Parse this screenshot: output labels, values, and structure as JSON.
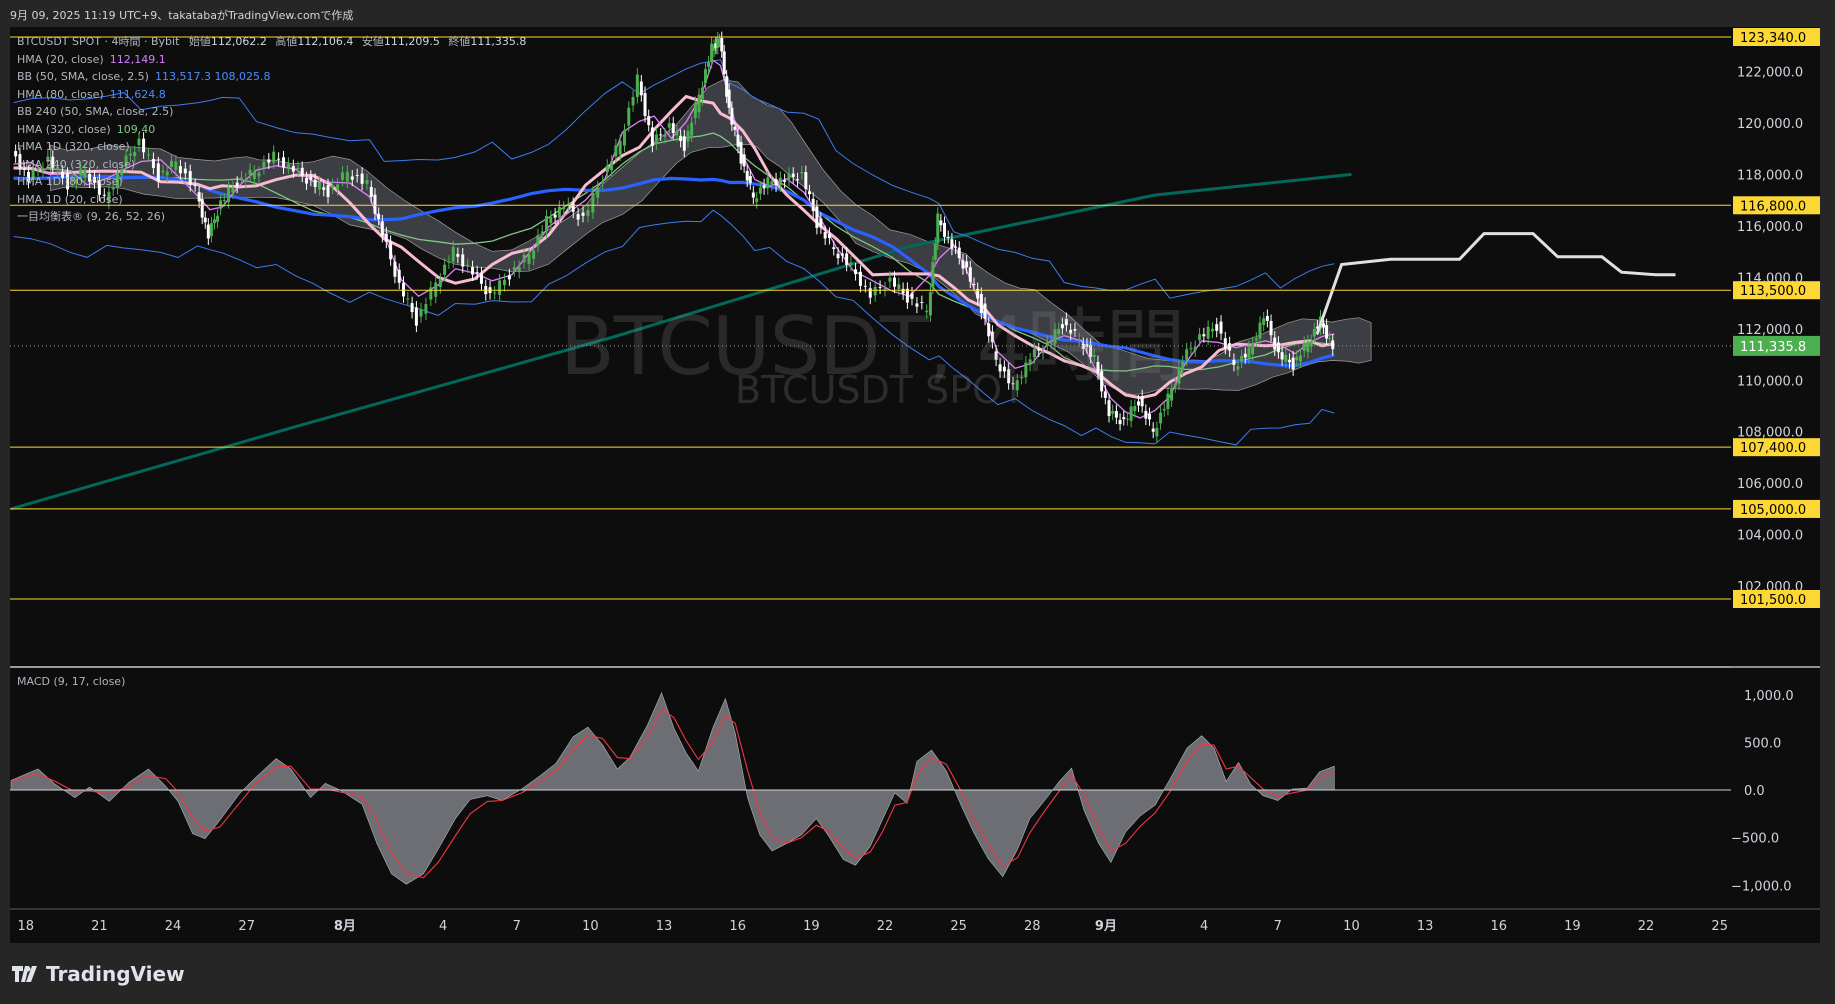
{
  "header": {
    "caption": "9月 09, 2025 11:19 UTC+9、takatabaがTradingView.comで作成"
  },
  "legend": {
    "symbol": "BTCUSDT SPOT · 4時間 · Bybit",
    "open_label": "始値",
    "open": "112,062.2",
    "high_label": "高値",
    "high": "112,106.4",
    "low_label": "安値",
    "low": "111,209.5",
    "close_label": "終値",
    "close": "111,335.8",
    "indicators": [
      {
        "label": "HMA (20, close)",
        "value": "112,149.1",
        "color": "#d580ff"
      },
      {
        "label": "BB (50, SMA, close, 2.5)",
        "value": "113,517.3  108,025.8",
        "color": "#4c8dff"
      },
      {
        "label": "HMA (80, close)",
        "value": "111,624.8",
        "color": "#4c8dff"
      },
      {
        "label": "BB 240 (50, SMA, close, 2.5)",
        "value": "",
        "color": ""
      },
      {
        "label": "HMA (320, close)",
        "value": "109,40",
        "color": "#81c784"
      },
      {
        "label": "HMA 1D (320, close)",
        "value": "",
        "color": ""
      },
      {
        "label": "HMA 240 (320, close)",
        "value": "",
        "color": ""
      },
      {
        "label": "HMA 1D (80, close)",
        "value": "",
        "color": ""
      },
      {
        "label": "HMA 1D (20, close)",
        "value": "",
        "color": ""
      },
      {
        "label": "一目均衡表® (9, 26, 52, 26)",
        "value": "",
        "color": ""
      }
    ]
  },
  "watermark": {
    "main": "BTCUSDT, 4時間",
    "sub": "BTCUSDT SPOT"
  },
  "macd_label": "MACD (9, 17, close)",
  "colors": {
    "background": "#0d0d0d",
    "up": "#4caf50",
    "down": "#ffffff",
    "hma20": "#e57fff",
    "hma80": "#f8bbd0",
    "bb": "#3d7cf0",
    "bb_mid": "#2962ff",
    "hma320": "#81c784",
    "long_ma": "#00695c",
    "level": "#fdd835",
    "price_tag": "#4caf50",
    "macd_hist": "#787b86",
    "signal": "#f23645"
  },
  "brand": "TradingView",
  "chart_data": [
    {
      "type": "candlestick",
      "title": "BTCUSDT SPOT · 4時間 · Bybit",
      "ylim": [
        101000,
        123500
      ],
      "y_ticks": [
        "122,000.0",
        "120,000.0",
        "118,000.0",
        "116,000.0",
        "114,000.0",
        "112,000.0",
        "110,000.0",
        "108,000.0",
        "106,000.0",
        "104,000.0",
        "102,000.0"
      ],
      "y_tick_values": [
        122000,
        120000,
        118000,
        116000,
        114000,
        112000,
        110000,
        108000,
        106000,
        104000,
        102000
      ],
      "x_ticks": [
        "18",
        "21",
        "24",
        "27",
        "8月",
        "4",
        "7",
        "10",
        "13",
        "16",
        "19",
        "22",
        "25",
        "28",
        "9月",
        "4",
        "7",
        "10",
        "13",
        "16",
        "19",
        "22",
        "25"
      ],
      "x_tick_days": [
        -14,
        -11,
        -8,
        -5,
        -1,
        3,
        6,
        9,
        12,
        15,
        18,
        21,
        24,
        27,
        30,
        34,
        37,
        40,
        43,
        46,
        49,
        52,
        55
      ],
      "last_price": "111,335.8",
      "last_price_value": 111335.8,
      "horizontal_levels": [
        {
          "label": "123,340.0",
          "value": 123340
        },
        {
          "label": "116,800.0",
          "value": 116800
        },
        {
          "label": "113,500.0",
          "value": 113500
        },
        {
          "label": "107,400.0",
          "value": 107400
        },
        {
          "label": "105,000.0",
          "value": 105000
        },
        {
          "label": "101,500.0",
          "value": 101500
        }
      ],
      "close_series": [
        [
          -14.5,
          119000
        ],
        [
          -13.8,
          117800
        ],
        [
          -13,
          118600
        ],
        [
          -12.2,
          117600
        ],
        [
          -11.5,
          118200
        ],
        [
          -10.7,
          117000
        ],
        [
          -10,
          118300
        ],
        [
          -9.3,
          119300
        ],
        [
          -8.5,
          117900
        ],
        [
          -7.8,
          118500
        ],
        [
          -7,
          117400
        ],
        [
          -6.5,
          115600
        ],
        [
          -6,
          116900
        ],
        [
          -5.3,
          117700
        ],
        [
          -4.6,
          118100
        ],
        [
          -3.8,
          118700
        ],
        [
          -3,
          118200
        ],
        [
          -2.3,
          117700
        ],
        [
          -1.6,
          117300
        ],
        [
          -0.8,
          118100
        ],
        [
          0,
          117600
        ],
        [
          0.6,
          115700
        ],
        [
          1.3,
          113700
        ],
        [
          2,
          112300
        ],
        [
          2.8,
          113800
        ],
        [
          3.5,
          115000
        ],
        [
          4.3,
          114200
        ],
        [
          5,
          113300
        ],
        [
          5.8,
          114100
        ],
        [
          6.6,
          114900
        ],
        [
          7.3,
          116200
        ],
        [
          8,
          116800
        ],
        [
          8.8,
          116300
        ],
        [
          9.6,
          117900
        ],
        [
          10.3,
          119300
        ],
        [
          11,
          121700
        ],
        [
          11.6,
          119200
        ],
        [
          12.3,
          119900
        ],
        [
          12.9,
          119100
        ],
        [
          13.5,
          121100
        ],
        [
          14,
          122900
        ],
        [
          14.3,
          123300
        ],
        [
          14.7,
          120500
        ],
        [
          15.2,
          118600
        ],
        [
          15.7,
          117100
        ],
        [
          16.3,
          117700
        ],
        [
          17,
          117800
        ],
        [
          17.7,
          118000
        ],
        [
          18.3,
          116100
        ],
        [
          19,
          115100
        ],
        [
          19.7,
          114400
        ],
        [
          20.5,
          113300
        ],
        [
          21.3,
          113900
        ],
        [
          22,
          113200
        ],
        [
          22.8,
          112700
        ],
        [
          23.2,
          116300
        ],
        [
          23.8,
          115200
        ],
        [
          24.4,
          114300
        ],
        [
          25,
          112800
        ],
        [
          25.6,
          110800
        ],
        [
          26.3,
          109700
        ],
        [
          27,
          110900
        ],
        [
          27.7,
          111400
        ],
        [
          28.3,
          112200
        ],
        [
          29,
          111600
        ],
        [
          29.6,
          110800
        ],
        [
          30.2,
          108700
        ],
        [
          30.8,
          108400
        ],
        [
          31.4,
          109200
        ],
        [
          32,
          108000
        ],
        [
          32.6,
          109300
        ],
        [
          33.2,
          110800
        ],
        [
          33.9,
          111700
        ],
        [
          34.6,
          112100
        ],
        [
          35.3,
          110600
        ],
        [
          35.9,
          111100
        ],
        [
          36.5,
          112500
        ],
        [
          37.1,
          111000
        ],
        [
          37.7,
          110600
        ],
        [
          38.3,
          111500
        ],
        [
          38.8,
          112300
        ],
        [
          39.3,
          111300
        ]
      ],
      "white_line": [
        [
          38.6,
          111800
        ],
        [
          39.6,
          114500
        ],
        [
          41.6,
          114700
        ],
        [
          44.4,
          114700
        ],
        [
          45.4,
          115700
        ],
        [
          47.4,
          115700
        ],
        [
          48.4,
          114800
        ],
        [
          50.2,
          114800
        ],
        [
          51.0,
          114200
        ],
        [
          52.4,
          114100
        ],
        [
          53.2,
          114100
        ]
      ],
      "long_ma": [
        [
          -14.6,
          105000
        ],
        [
          -3,
          108200
        ],
        [
          10,
          111700
        ],
        [
          22,
          115200
        ],
        [
          32,
          117200
        ],
        [
          40,
          118000
        ]
      ],
      "series": [
        {
          "name": "HMA (20, close)",
          "last": 112149.1
        },
        {
          "name": "BB (50, SMA, close, 2.5) upper",
          "last": 113517.3
        },
        {
          "name": "BB (50, SMA, close, 2.5) lower",
          "last": 108025.8
        },
        {
          "name": "HMA (80, close)",
          "last": 111624.8
        }
      ]
    },
    {
      "type": "area",
      "title": "MACD (9, 17, close)",
      "ylim": [
        -1200,
        1000
      ],
      "y_ticks": [
        "1,000.0",
        "500.0",
        "0.0",
        "−500.0",
        "−1,000.0"
      ],
      "y_tick_values": [
        1000,
        500,
        0,
        -500,
        -1000
      ],
      "histogram": [
        [
          -14.6,
          100
        ],
        [
          -13.5,
          220
        ],
        [
          -12.8,
          60
        ],
        [
          -12,
          -80
        ],
        [
          -11.4,
          30
        ],
        [
          -10.6,
          -120
        ],
        [
          -9.8,
          80
        ],
        [
          -9,
          220
        ],
        [
          -8.3,
          40
        ],
        [
          -7.8,
          -120
        ],
        [
          -7.2,
          -460
        ],
        [
          -6.7,
          -510
        ],
        [
          -6.1,
          -320
        ],
        [
          -5.3,
          -40
        ],
        [
          -4.6,
          140
        ],
        [
          -3.8,
          330
        ],
        [
          -3.2,
          220
        ],
        [
          -2.4,
          -80
        ],
        [
          -1.8,
          70
        ],
        [
          -1.2,
          0
        ],
        [
          -0.3,
          -150
        ],
        [
          0.3,
          -560
        ],
        [
          0.9,
          -880
        ],
        [
          1.5,
          -990
        ],
        [
          2.2,
          -880
        ],
        [
          2.8,
          -620
        ],
        [
          3.5,
          -300
        ],
        [
          4.1,
          -100
        ],
        [
          4.8,
          -60
        ],
        [
          5.4,
          -110
        ],
        [
          6.2,
          10
        ],
        [
          6.9,
          140
        ],
        [
          7.6,
          280
        ],
        [
          8.3,
          560
        ],
        [
          8.9,
          660
        ],
        [
          9.5,
          470
        ],
        [
          10.1,
          220
        ],
        [
          10.6,
          340
        ],
        [
          11.3,
          670
        ],
        [
          11.9,
          1020
        ],
        [
          12.4,
          650
        ],
        [
          12.9,
          390
        ],
        [
          13.4,
          200
        ],
        [
          14,
          660
        ],
        [
          14.5,
          960
        ],
        [
          14.9,
          600
        ],
        [
          15.4,
          -80
        ],
        [
          15.9,
          -470
        ],
        [
          16.4,
          -640
        ],
        [
          17,
          -560
        ],
        [
          17.6,
          -470
        ],
        [
          18.2,
          -300
        ],
        [
          18.7,
          -480
        ],
        [
          19.3,
          -730
        ],
        [
          19.8,
          -790
        ],
        [
          20.4,
          -590
        ],
        [
          20.9,
          -310
        ],
        [
          21.4,
          -30
        ],
        [
          21.9,
          -140
        ],
        [
          22.3,
          300
        ],
        [
          22.9,
          420
        ],
        [
          23.5,
          200
        ],
        [
          24.1,
          -160
        ],
        [
          24.6,
          -440
        ],
        [
          25.2,
          -720
        ],
        [
          25.8,
          -910
        ],
        [
          26.4,
          -620
        ],
        [
          26.9,
          -300
        ],
        [
          27.5,
          -110
        ],
        [
          28.1,
          90
        ],
        [
          28.6,
          230
        ],
        [
          29.1,
          -210
        ],
        [
          29.7,
          -560
        ],
        [
          30.2,
          -760
        ],
        [
          30.8,
          -440
        ],
        [
          31.4,
          -270
        ],
        [
          32,
          -160
        ],
        [
          32.6,
          110
        ],
        [
          33.3,
          440
        ],
        [
          33.9,
          570
        ],
        [
          34.4,
          440
        ],
        [
          34.9,
          90
        ],
        [
          35.4,
          290
        ],
        [
          35.9,
          60
        ],
        [
          36.4,
          -60
        ],
        [
          37,
          -110
        ],
        [
          37.6,
          10
        ],
        [
          38.2,
          20
        ],
        [
          38.7,
          190
        ],
        [
          39.3,
          250
        ]
      ],
      "signal": [
        [
          -14.6,
          90
        ],
        [
          -13.5,
          170
        ],
        [
          -12.8,
          90
        ],
        [
          -12,
          -20
        ],
        [
          -11.4,
          -10
        ],
        [
          -10.6,
          -40
        ],
        [
          -9.8,
          40
        ],
        [
          -9,
          150
        ],
        [
          -8.3,
          120
        ],
        [
          -7.8,
          -20
        ],
        [
          -7.2,
          -290
        ],
        [
          -6.7,
          -430
        ],
        [
          -6.1,
          -390
        ],
        [
          -5.3,
          -140
        ],
        [
          -4.6,
          80
        ],
        [
          -3.8,
          240
        ],
        [
          -3.2,
          250
        ],
        [
          -2.4,
          10
        ],
        [
          -1.8,
          10
        ],
        [
          -1.2,
          -20
        ],
        [
          -0.3,
          -70
        ],
        [
          0.3,
          -320
        ],
        [
          0.9,
          -660
        ],
        [
          1.5,
          -880
        ],
        [
          2.2,
          -920
        ],
        [
          2.8,
          -760
        ],
        [
          3.5,
          -480
        ],
        [
          4.1,
          -250
        ],
        [
          4.8,
          -120
        ],
        [
          5.4,
          -110
        ],
        [
          6.2,
          -30
        ],
        [
          6.9,
          80
        ],
        [
          7.6,
          200
        ],
        [
          8.3,
          420
        ],
        [
          8.9,
          580
        ],
        [
          9.5,
          540
        ],
        [
          10.1,
          340
        ],
        [
          10.6,
          330
        ],
        [
          11.3,
          540
        ],
        [
          11.9,
          850
        ],
        [
          12.4,
          760
        ],
        [
          12.9,
          520
        ],
        [
          13.4,
          320
        ],
        [
          14,
          510
        ],
        [
          14.5,
          780
        ],
        [
          14.9,
          700
        ],
        [
          15.4,
          210
        ],
        [
          15.9,
          -230
        ],
        [
          16.4,
          -500
        ],
        [
          17,
          -560
        ],
        [
          17.6,
          -500
        ],
        [
          18.2,
          -370
        ],
        [
          18.7,
          -430
        ],
        [
          19.3,
          -610
        ],
        [
          19.8,
          -720
        ],
        [
          20.4,
          -650
        ],
        [
          20.9,
          -440
        ],
        [
          21.4,
          -160
        ],
        [
          21.9,
          -130
        ],
        [
          22.3,
          150
        ],
        [
          22.9,
          340
        ],
        [
          23.5,
          270
        ],
        [
          24.1,
          -10
        ],
        [
          24.6,
          -300
        ],
        [
          25.2,
          -570
        ],
        [
          25.8,
          -800
        ],
        [
          26.4,
          -710
        ],
        [
          26.9,
          -450
        ],
        [
          27.5,
          -220
        ],
        [
          28.1,
          -10
        ],
        [
          28.6,
          160
        ],
        [
          29.1,
          -50
        ],
        [
          29.7,
          -400
        ],
        [
          30.2,
          -640
        ],
        [
          30.8,
          -560
        ],
        [
          31.4,
          -380
        ],
        [
          32,
          -240
        ],
        [
          32.6,
          -20
        ],
        [
          33.3,
          300
        ],
        [
          33.9,
          480
        ],
        [
          34.4,
          470
        ],
        [
          34.9,
          220
        ],
        [
          35.4,
          250
        ],
        [
          35.9,
          130
        ],
        [
          36.4,
          10
        ],
        [
          37,
          -70
        ],
        [
          37.6,
          -30
        ],
        [
          38.2,
          0
        ],
        [
          38.7,
          120
        ],
        [
          39.3,
          200
        ]
      ]
    }
  ]
}
